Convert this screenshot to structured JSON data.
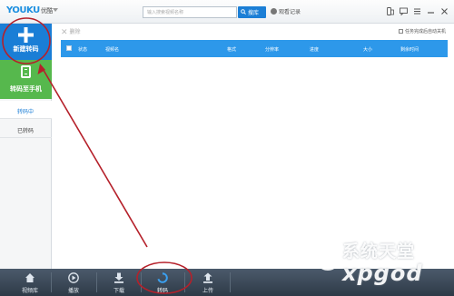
{
  "app": {
    "logo_latin": "YOUKU",
    "logo_cn": "优酷"
  },
  "search": {
    "placeholder": "输入搜索视频名称",
    "button_label": "搜库"
  },
  "history_label": "观看记录",
  "sidebar": {
    "new_button": "新建转码",
    "phone_button": "转码至手机",
    "tab_active": "转码中",
    "tab_done": "已转码"
  },
  "toolbar": {
    "delete_label": "删除",
    "auto_shutdown_label": "任务完成后自动关机",
    "auto_shutdown_checked": false
  },
  "table": {
    "columns": [
      "状态",
      "视频名",
      "格式",
      "分辨率",
      "进度",
      "大小",
      "剩余时间"
    ],
    "rows": []
  },
  "bottom_nav": [
    {
      "label": "视频库",
      "icon": "home-icon"
    },
    {
      "label": "播放",
      "icon": "play-icon"
    },
    {
      "label": "下载",
      "icon": "download-icon"
    },
    {
      "label": "转码",
      "icon": "transcode-icon",
      "active": true
    },
    {
      "label": "上传",
      "icon": "upload-icon"
    }
  ],
  "watermark": {
    "cn": "系统天堂",
    "en": "xpgod"
  },
  "colors": {
    "accent_blue": "#1a7ed6",
    "header_blue": "#2d98ea",
    "phone_green": "#56b84d",
    "bottom_bar": "#3a4756",
    "annotation_red": "#b5202a"
  }
}
